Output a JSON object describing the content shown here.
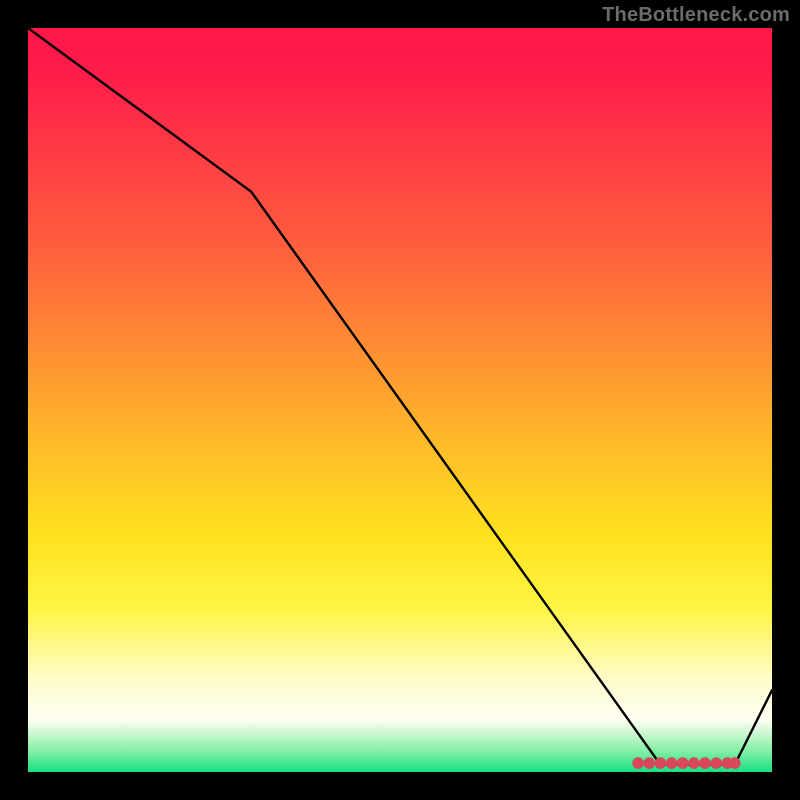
{
  "attribution": "TheBottleneck.com",
  "chart_data": {
    "type": "line",
    "title": "",
    "xlabel": "",
    "ylabel": "",
    "xlim": [
      0,
      100
    ],
    "ylim": [
      0,
      100
    ],
    "grid": false,
    "legend": false,
    "series": [
      {
        "name": "curve",
        "x": [
          0,
          30,
          85,
          95,
          100
        ],
        "y": [
          100,
          78,
          1,
          1,
          11
        ]
      }
    ],
    "markers": {
      "name": "cluster-pink-dots",
      "color": "#d8475a",
      "x": [
        82,
        83.5,
        85,
        86.5,
        88,
        89.5,
        91,
        92.5,
        94,
        95
      ],
      "y": [
        1.2,
        1.2,
        1.2,
        1.2,
        1.2,
        1.2,
        1.2,
        1.2,
        1.2,
        1.2
      ]
    }
  }
}
